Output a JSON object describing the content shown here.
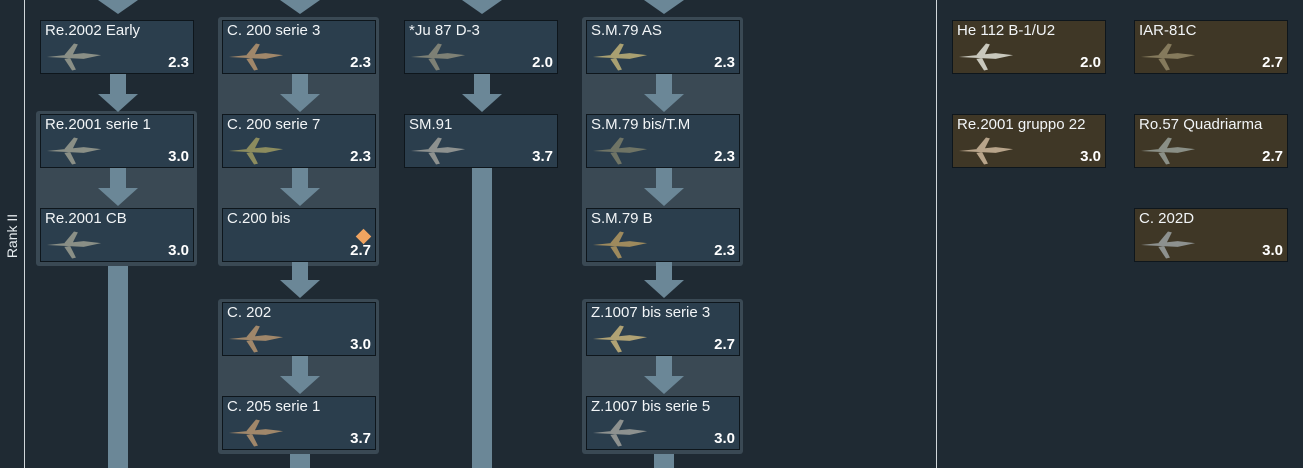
{
  "rank": {
    "label": "Rank II"
  },
  "tree": [
    {
      "name": "Re.2002 Early",
      "br": "2.3"
    },
    {
      "name": "Re.2001 serie 1",
      "br": "3.0"
    },
    {
      "name": "Re.2001 CB",
      "br": "3.0"
    },
    {
      "name": "C. 200 serie 3",
      "br": "2.3"
    },
    {
      "name": "C. 200 serie 7",
      "br": "2.3"
    },
    {
      "name": "C.200 bis",
      "br": "2.7"
    },
    {
      "name": "C. 202",
      "br": "3.0"
    },
    {
      "name": "C. 205 serie 1",
      "br": "3.7"
    },
    {
      "name": "*Ju 87 D-3",
      "br": "2.0"
    },
    {
      "name": "SM.91",
      "br": "3.7"
    },
    {
      "name": "S.M.79 AS",
      "br": "2.3"
    },
    {
      "name": "S.M.79 bis/T.M",
      "br": "2.3"
    },
    {
      "name": "S.M.79 B",
      "br": "2.3"
    },
    {
      "name": "Z.1007 bis serie 3",
      "br": "2.7"
    },
    {
      "name": "Z.1007 bis serie 5",
      "br": "3.0"
    }
  ],
  "premium": [
    {
      "name": "He 112 B-1/U2",
      "br": "2.0"
    },
    {
      "name": "IAR-81C",
      "br": "2.7"
    },
    {
      "name": "Re.2001 gruppo 22",
      "br": "3.0"
    },
    {
      "name": "Ro.57 Quadriarma",
      "br": "2.7"
    },
    {
      "name": "C. 202D",
      "br": "3.0"
    }
  ],
  "colors": {
    "card_bg": "#2b3e4d",
    "premium_bg": "#3f3726",
    "connector": "#6b8797",
    "group_bg": "#3a4954",
    "research_marker": "#f0a460"
  },
  "icons": {
    "aircraft": "aircraft-icon",
    "research_marker": "research-diamond-icon"
  }
}
